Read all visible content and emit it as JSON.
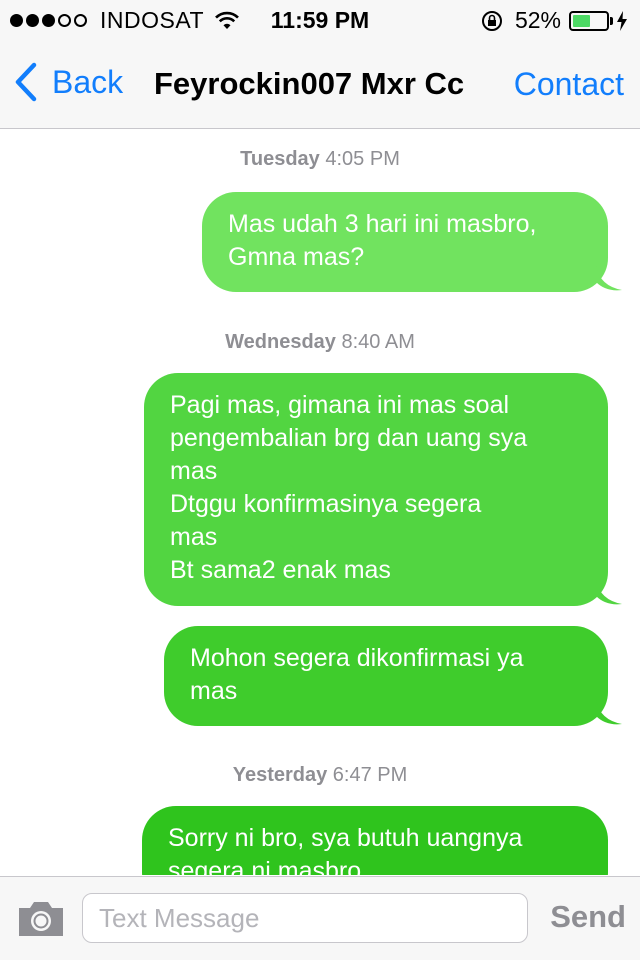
{
  "status_bar": {
    "carrier": "INDOSAT",
    "time": "11:59 PM",
    "battery_percent": "52%",
    "battery_level": 0.52,
    "signal_bars_filled": 3,
    "signal_bars_total": 5,
    "icons": [
      "wifi-icon",
      "rotation-lock-icon",
      "battery-icon",
      "charging-bolt-icon"
    ]
  },
  "nav": {
    "back_label": "Back",
    "title": "Feyrockin007 Mxr Cc",
    "contact_label": "Contact"
  },
  "conversation": {
    "timestamps": [
      {
        "day": "Tuesday",
        "time": "4:05 PM"
      },
      {
        "day": "Wednesday",
        "time": "8:40 AM"
      },
      {
        "day": "Yesterday",
        "time": "6:47 PM"
      }
    ],
    "messages": [
      {
        "sender": "me",
        "text": "Mas udah 3 hari ini masbro,\nGmna mas?"
      },
      {
        "sender": "me",
        "text": "Pagi mas, gimana ini mas soal\npengembalian brg dan uang sya\nmas\nDtggu konfirmasinya segera\nmas\nBt sama2 enak mas"
      },
      {
        "sender": "me",
        "text": "Mohon segera dikonfirmasi ya\nmas"
      },
      {
        "sender": "me",
        "text": "Sorry ni bro, sya butuh uangnya\nsegera ni masbro"
      }
    ]
  },
  "input_bar": {
    "placeholder": "Text Message",
    "send_label": "Send"
  },
  "colors": {
    "accent": "#127efc",
    "bubble_light": "#71e35f",
    "bubble_mid": "#4bd23a",
    "bubble_dark": "#2fc41d",
    "timestamp": "#8e8e93",
    "bar_background": "#f7f7f7"
  }
}
